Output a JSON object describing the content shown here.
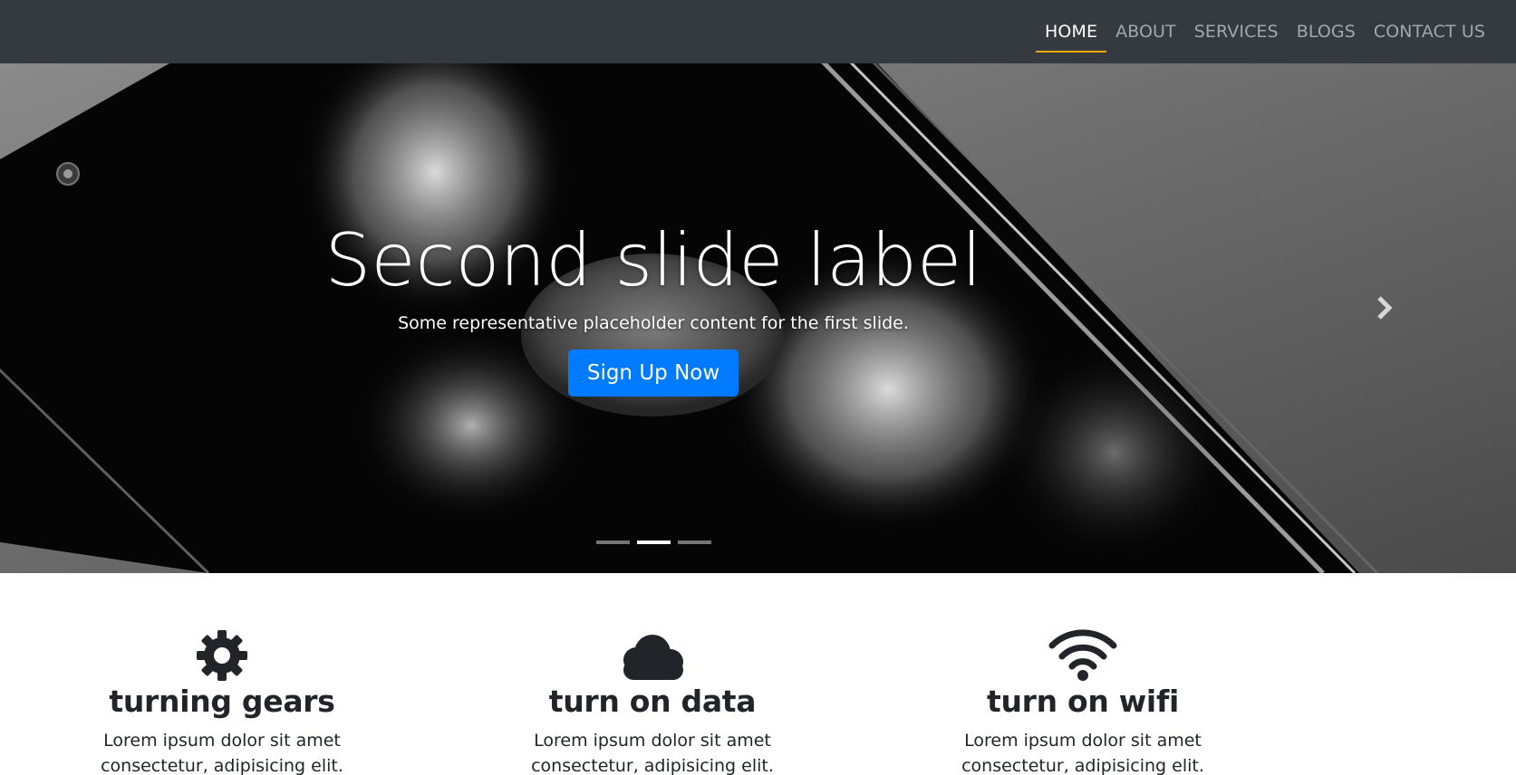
{
  "nav": {
    "items": [
      {
        "label": "HOME",
        "active": true
      },
      {
        "label": "ABOUT",
        "active": false
      },
      {
        "label": "SERVICES",
        "active": false
      },
      {
        "label": "BLOGS",
        "active": false
      },
      {
        "label": "CONTACT US",
        "active": false
      }
    ]
  },
  "hero": {
    "title": "Second slide label",
    "subtitle": "Some representative placeholder content for the first slide.",
    "button_label": "Sign Up Now",
    "next_icon": "chevron-right-icon",
    "slide_count": 3,
    "active_slide": 2
  },
  "features": [
    {
      "icon": "gear-icon",
      "title": "turning gears",
      "text": "Lorem ipsum dolor sit amet consectetur, adipisicing elit. Voluptatum quos"
    },
    {
      "icon": "cloud-icon",
      "title": "turn on data",
      "text": "Lorem ipsum dolor sit amet consectetur, adipisicing elit. Voluptatum quos"
    },
    {
      "icon": "wifi-icon",
      "title": "turn on wifi",
      "text": "Lorem ipsum dolor sit amet consectetur, adipisicing elit. Voluptatum quos"
    }
  ],
  "colors": {
    "navbar_bg": "#343a40",
    "nav_active_underline": "#f0a500",
    "button_primary": "#007bff"
  }
}
